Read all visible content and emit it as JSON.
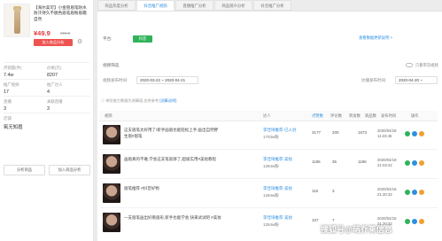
{
  "product": {
    "title": "【海尔美可】小金管眉笔防水防汗持久不脱色眉笔眉粉眉霜自然",
    "price": "¥49.9",
    "orig_price": "¥58.8",
    "analyze_button": "加入商品分析",
    "stats": [
      {
        "label": "月销量(件)",
        "value": "7.4w"
      },
      {
        "label": "价格(元)",
        "value": "8207"
      },
      {
        "label": "推广视频",
        "value": "17"
      },
      {
        "label": "推广达人",
        "value": "4"
      },
      {
        "label": "直播",
        "value": "3"
      },
      {
        "label": "关联直播",
        "value": "3"
      },
      {
        "label": "店铺",
        "value": "氧无知眉"
      },
      {
        "label": "",
        "value": ""
      }
    ],
    "left_buttons": [
      "分析商品",
      "加入商品分析"
    ]
  },
  "tabs": [
    "商品热度分析",
    "抖音推广视频",
    "直播推广分析",
    "商品观众分析",
    "抖音推广分析"
  ],
  "active_tab": 1,
  "filters": {
    "platform_label": "平台:",
    "platform_chip": "抖音",
    "top_link": "查看数据更新说明 >",
    "section_label": "视频筛选",
    "toggle_text": "只看带货视频",
    "date_label": "视频发布时间:",
    "date_range": "2020-03-22 ~ 2020-04-21",
    "date2_label": "达播发布时间:",
    "date2_range": "2020-04-20 ~"
  },
  "tip": {
    "text": "带货能力数据为测算值,仅供参考 ",
    "link": "[测算说明]"
  },
  "table": {
    "columns": [
      "视频",
      "达人",
      "点赞数",
      "评论数",
      "转发数",
      "商品数",
      "发布时间",
      "操作"
    ],
    "rows": [
      {
        "title": "这支眉笔太好用了!新手画眉也能轻松上手,画出自然野生眉#眉笔",
        "author": "李佳琦推荐·已入驻",
        "fans": "1703w粉",
        "likes": "3177",
        "comments": "200",
        "shares": "1673",
        "goods": "",
        "date": "2020/04/18 11:23:45",
        "ops": [
          "g",
          "b",
          "o"
        ]
      },
      {
        "title": "画眉真的不难,学会这支笔就够了,超级实用#美妆教程",
        "author": "李佳琦推荐·美妆",
        "fans": "1284w粉",
        "likes": "1186",
        "comments": "35",
        "shares": "1186",
        "goods": "",
        "date": "2020/04/19 21:03:42",
        "ops": [
          "g",
          "b",
          "o"
        ]
      },
      {
        "title": "眉笔推荐 #抖音好物",
        "author": "李佳琦推荐·美妆",
        "fans": "1284w粉",
        "likes": "115",
        "comments": "3",
        "shares": "",
        "goods": "",
        "date": "2020/04/16 21:20:32",
        "ops": [
          "g",
          "b",
          "o"
        ]
      },
      {
        "title": "一支眉笔画出好看眉形,新手也能学会,快来试试吧 #美妆",
        "author": "李佳琦推荐·美妆",
        "fans": "1284w粉",
        "likes": "107",
        "comments": "7",
        "shares": "",
        "goods": "",
        "date": "2020/04/16 21:20:32",
        "ops": [
          "g",
          "b",
          "o"
        ]
      }
    ]
  },
  "watermark": "搜狐号@萌乔莱信息"
}
